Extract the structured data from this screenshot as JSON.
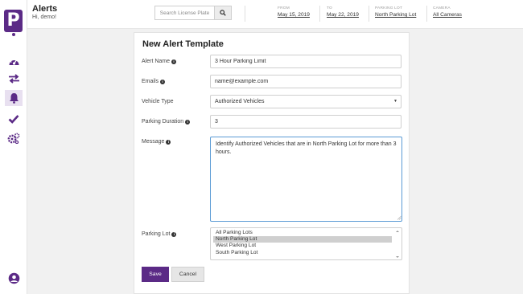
{
  "header": {
    "title": "Alerts",
    "greeting": "Hi, demo!",
    "search_placeholder": "Search License Plate",
    "from": {
      "label": "FROM",
      "value": "May 15, 2019"
    },
    "to": {
      "label": "TO",
      "value": "May 22, 2019"
    },
    "parking_lot": {
      "label": "PARKING LOT",
      "value": "North Parking Lot"
    },
    "camera": {
      "label": "CAMERA",
      "value": "All Cameras"
    }
  },
  "sidebar": {
    "logo_letter": "P",
    "icons": [
      "dashboard-icon",
      "transfer-icon",
      "bell-icon",
      "check-icon",
      "settings-icon",
      "user-icon"
    ]
  },
  "form": {
    "title": "New Alert Template",
    "alert_name": {
      "label": "Alert Name",
      "value": "3 Hour Parking Limit"
    },
    "emails": {
      "label": "Emails",
      "value": "name@example.com"
    },
    "vehicle_type": {
      "label": "Vehicle Type",
      "value": "Authorized Vehicles"
    },
    "parking_duration": {
      "label": "Parking Duration",
      "value": "3"
    },
    "message": {
      "label": "Message",
      "value": "Identify Authorized Vehicles that are in North Parking Lot for more than 3 hours."
    },
    "parking_lot": {
      "label": "Parking Lot",
      "options": [
        "All Parking Lots",
        "North Parking Lot",
        "West Parking Lot",
        "South Parking Lot"
      ],
      "selected": "North Parking Lot"
    },
    "save_label": "Save",
    "cancel_label": "Cancel"
  },
  "colors": {
    "brand": "#5b2a86",
    "focus_border": "#5b9bd5"
  }
}
